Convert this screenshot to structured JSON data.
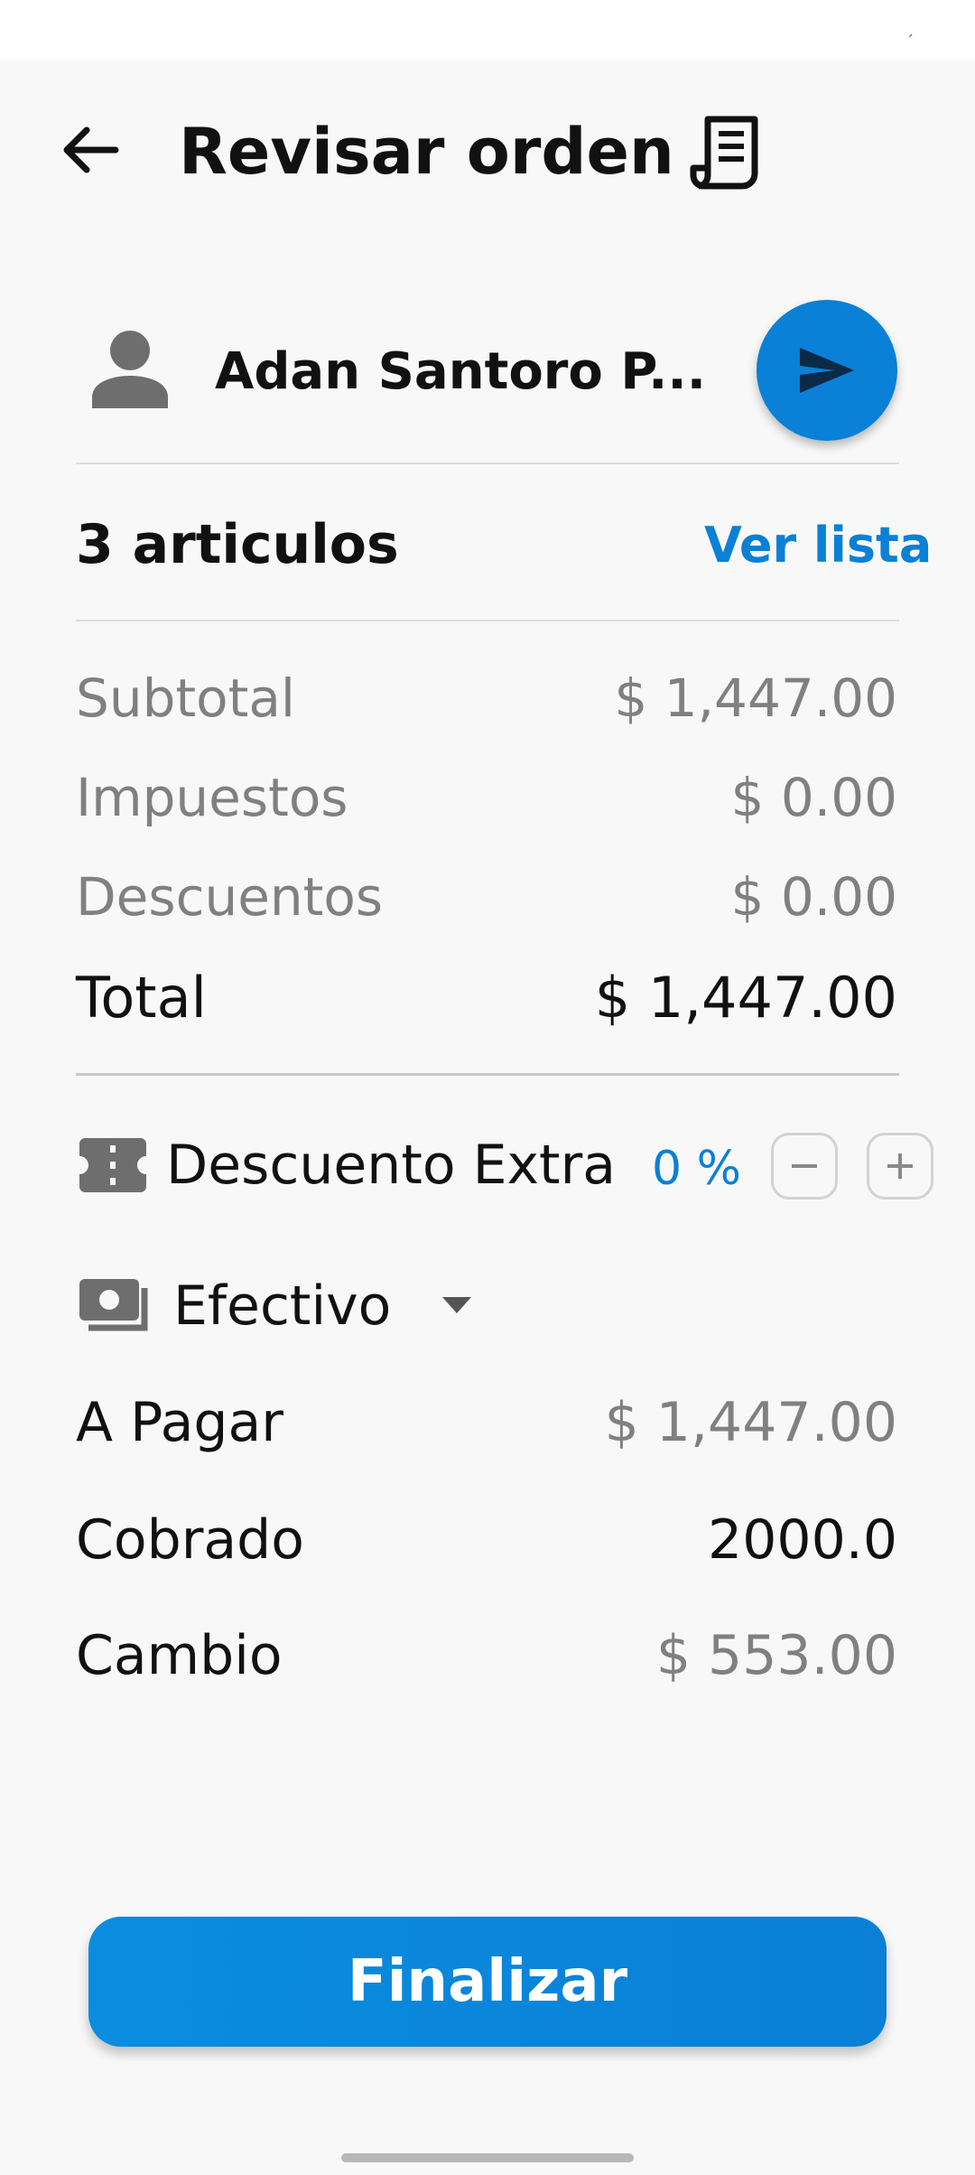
{
  "header": {
    "title": "Revisar orden",
    "back_icon": "arrow-left-icon",
    "receipt_icon": "receipt-icon"
  },
  "customer": {
    "name": "Adan Santoro P...",
    "avatar_icon": "person-icon",
    "send_icon": "send-icon"
  },
  "items": {
    "count_label": "3 articulos",
    "view_list_label": "Ver lista"
  },
  "summary": {
    "subtotal_label": "Subtotal",
    "subtotal_value": "$ 1,447.00",
    "taxes_label": "Impuestos",
    "taxes_value": "$ 0.00",
    "discounts_label": "Descuentos",
    "discounts_value": "$ 0.00",
    "total_label": "Total",
    "total_value": "$ 1,447.00"
  },
  "extra_discount": {
    "label": "Descuento Extra",
    "value": "0 %",
    "minus_symbol": "−",
    "plus_symbol": "+"
  },
  "payment": {
    "method": "Efectivo",
    "to_pay_label": "A Pagar",
    "to_pay_value": "$ 1,447.00",
    "charged_label": "Cobrado",
    "charged_value": "2000.0",
    "change_label": "Cambio",
    "change_value": "$ 553.00"
  },
  "actions": {
    "finalize_label": "Finalizar"
  },
  "colors": {
    "accent": "#0a80d6",
    "background": "#f8f8f8",
    "muted_text": "#808080"
  }
}
